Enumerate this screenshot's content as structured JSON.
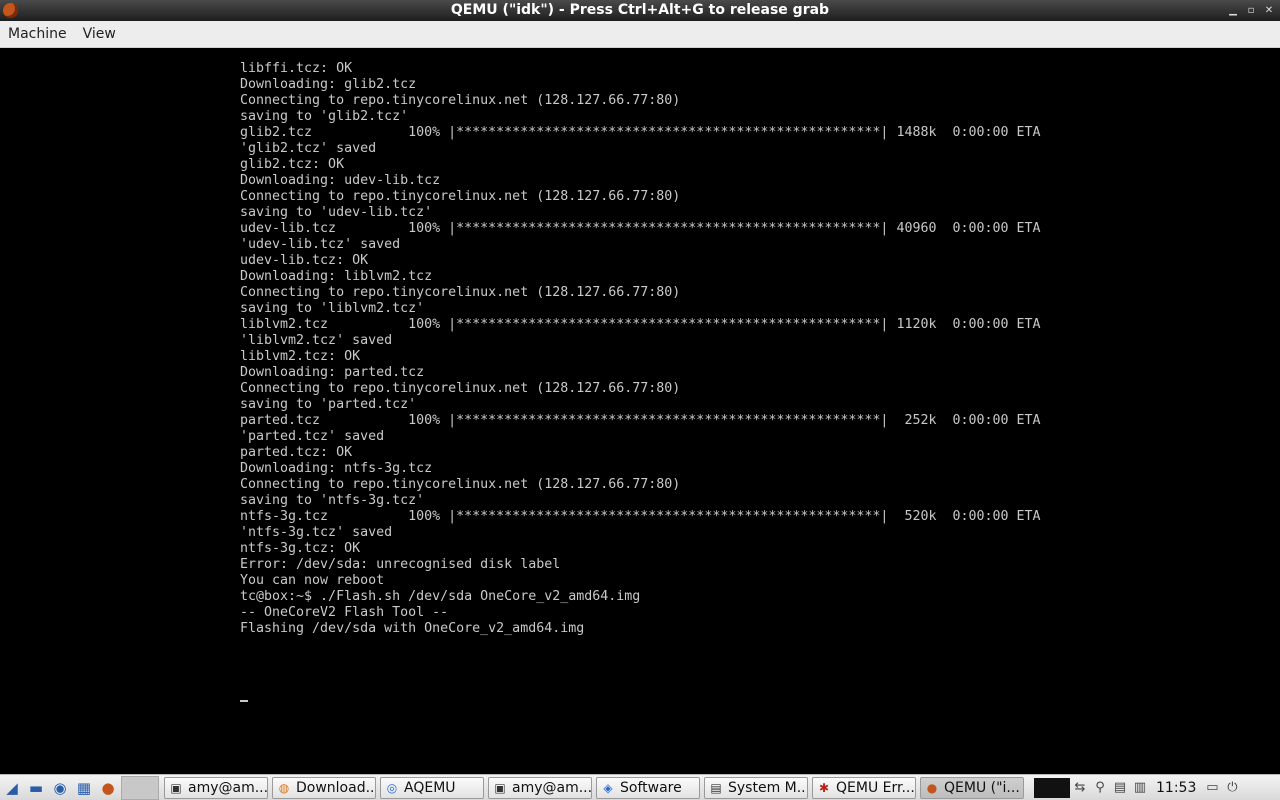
{
  "window": {
    "title": "QEMU (\"idk\") - Press Ctrl+Alt+G to release grab"
  },
  "menu": {
    "machine": "Machine",
    "view": "View"
  },
  "console": {
    "lines": [
      "libffi.tcz: OK",
      "Downloading: glib2.tcz",
      "Connecting to repo.tinycorelinux.net (128.127.66.77:80)",
      "saving to 'glib2.tcz'",
      "glib2.tcz            100% |*****************************************************| 1488k  0:00:00 ETA",
      "'glib2.tcz' saved",
      "glib2.tcz: OK",
      "Downloading: udev-lib.tcz",
      "Connecting to repo.tinycorelinux.net (128.127.66.77:80)",
      "saving to 'udev-lib.tcz'",
      "udev-lib.tcz         100% |*****************************************************| 40960  0:00:00 ETA",
      "'udev-lib.tcz' saved",
      "udev-lib.tcz: OK",
      "Downloading: liblvm2.tcz",
      "Connecting to repo.tinycorelinux.net (128.127.66.77:80)",
      "saving to 'liblvm2.tcz'",
      "liblvm2.tcz          100% |*****************************************************| 1120k  0:00:00 ETA",
      "'liblvm2.tcz' saved",
      "liblvm2.tcz: OK",
      "Downloading: parted.tcz",
      "Connecting to repo.tinycorelinux.net (128.127.66.77:80)",
      "saving to 'parted.tcz'",
      "parted.tcz           100% |*****************************************************|  252k  0:00:00 ETA",
      "'parted.tcz' saved",
      "parted.tcz: OK",
      "Downloading: ntfs-3g.tcz",
      "Connecting to repo.tinycorelinux.net (128.127.66.77:80)",
      "saving to 'ntfs-3g.tcz'",
      "ntfs-3g.tcz          100% |*****************************************************|  520k  0:00:00 ETA",
      "'ntfs-3g.tcz' saved",
      "ntfs-3g.tcz: OK",
      "Error: /dev/sda: unrecognised disk label",
      "You can now reboot",
      "tc@box:~$ ./Flash.sh /dev/sda OneCore_v2_amd64.img",
      "-- OneCoreV2 Flash Tool --",
      "Flashing /dev/sda with OneCore_v2_amd64.img"
    ]
  },
  "taskbar": {
    "tasks": [
      {
        "label": "amy@am...",
        "icon": "terminal-icon"
      },
      {
        "label": "Download...",
        "icon": "firefox-icon"
      },
      {
        "label": "AQEMU",
        "icon": "aqemu-icon"
      },
      {
        "label": "amy@am...",
        "icon": "terminal-icon"
      },
      {
        "label": "Software",
        "icon": "software-icon"
      },
      {
        "label": "System M...",
        "icon": "system-monitor-icon"
      },
      {
        "label": "QEMU Err...",
        "icon": "bug-icon"
      },
      {
        "label": "QEMU (\"i...",
        "icon": "qemu-icon"
      }
    ],
    "clock": "11:53"
  }
}
